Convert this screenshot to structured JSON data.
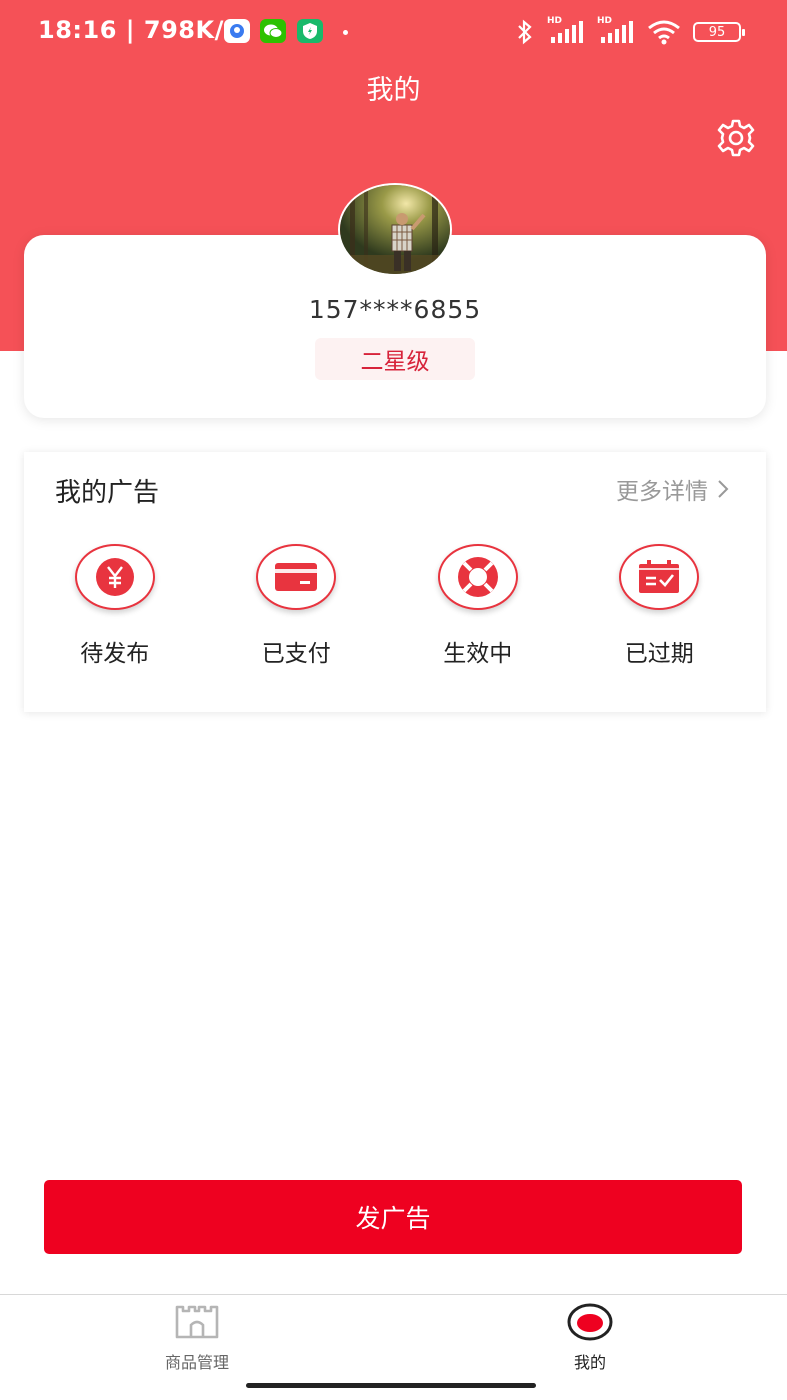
{
  "status_bar": {
    "time": "18:16",
    "speed": "798K/s",
    "battery": "95",
    "network_labels": [
      "HD",
      "HD"
    ]
  },
  "header": {
    "title": "我的",
    "background_color": "#F55157",
    "settings_icon": "gear-icon"
  },
  "profile": {
    "phone": "157****6855",
    "level": "二星级",
    "avatar_icon": "avatar-photo"
  },
  "my_ads": {
    "title": "我的广告",
    "more_label": "更多详情",
    "items": [
      {
        "label": "待发布",
        "icon": "yen-icon"
      },
      {
        "label": "已支付",
        "icon": "card-icon"
      },
      {
        "label": "生效中",
        "icon": "lifebuoy-icon"
      },
      {
        "label": "已过期",
        "icon": "calendar-check-icon"
      }
    ],
    "accent_color": "#E8343F"
  },
  "publish_button": {
    "label": "发广告",
    "color": "#EE0120"
  },
  "tabbar": {
    "tabs": [
      {
        "label": "商品管理",
        "icon": "store-icon",
        "active": false
      },
      {
        "label": "我的",
        "icon": "profile-tab-icon",
        "active": true
      }
    ]
  }
}
